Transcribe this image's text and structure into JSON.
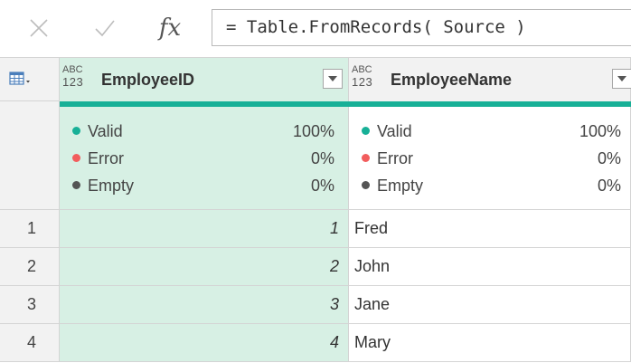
{
  "formula_bar": {
    "icons": [
      "cancel-icon",
      "commit-check-icon",
      "fx-icon"
    ],
    "fx_label": "fx",
    "formula": "= Table.FromRecords( Source )"
  },
  "table": {
    "columns": [
      {
        "type_top": "ABC",
        "type_bottom": "123",
        "name": "EmployeeID",
        "selected": true
      },
      {
        "type_top": "ABC",
        "type_bottom": "123",
        "name": "EmployeeName",
        "selected": false
      }
    ],
    "quality": [
      [
        {
          "label": "Valid",
          "value": "100%",
          "color": "#17b097"
        },
        {
          "label": "Error",
          "value": "0%",
          "color": "#f25d5d"
        },
        {
          "label": "Empty",
          "value": "0%",
          "color": "#555555"
        }
      ],
      [
        {
          "label": "Valid",
          "value": "100%",
          "color": "#17b097"
        },
        {
          "label": "Error",
          "value": "0%",
          "color": "#f25d5d"
        },
        {
          "label": "Empty",
          "value": "0%",
          "color": "#555555"
        }
      ]
    ],
    "rows": [
      {
        "num": "1",
        "id": "1",
        "name": "Fred"
      },
      {
        "num": "2",
        "id": "2",
        "name": "John"
      },
      {
        "num": "3",
        "id": "3",
        "name": "Jane"
      },
      {
        "num": "4",
        "id": "4",
        "name": "Mary"
      }
    ]
  },
  "colors": {
    "selected_column_bg": "#d7f0e4",
    "quality_bar": "#17b097",
    "header_bg": "#f2f2f2",
    "gridline": "#d4d4d4"
  }
}
